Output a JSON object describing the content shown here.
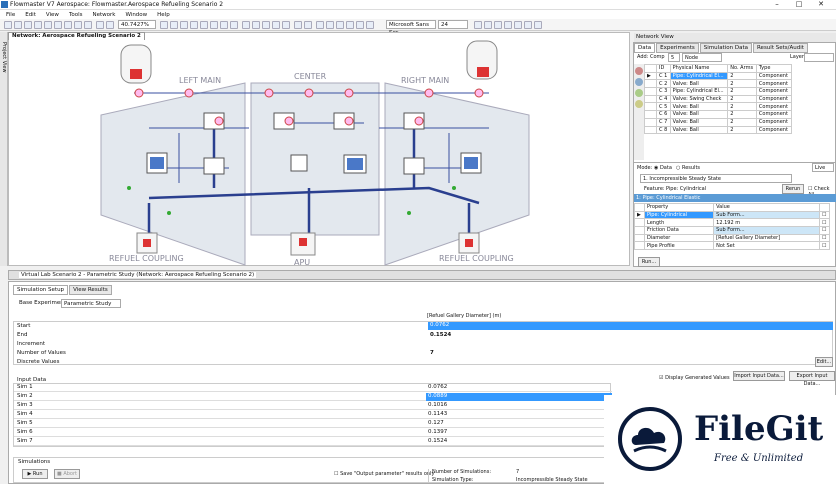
{
  "window": {
    "title": "Flowmaster V7 Aerospace: Flowmaster.Aerospace Refueling Scenario 2"
  },
  "menu": [
    "File",
    "Edit",
    "View",
    "Tools",
    "Network",
    "Window",
    "Help"
  ],
  "toolbar": {
    "zoom": "40.7427%",
    "font": "Microsoft Sans Ser",
    "size": "24"
  },
  "canvas": {
    "tab": "Network: Aerospace Refueling Scenario 2",
    "side_tab": "Project View",
    "labels": {
      "left_main": "LEFT MAIN",
      "center": "CENTER",
      "right_main": "RIGHT MAIN",
      "refuel_left": "REFUEL COUPLING",
      "refuel_right": "REFUEL COUPLING",
      "apu": "APU"
    }
  },
  "netview": {
    "title": "Network View",
    "tabs": [
      "Data",
      "Experiments",
      "Simulation Data",
      "Result Sets/Audit"
    ],
    "add_comp": "Add: Comp",
    "node": "Node",
    "layer": "Layer",
    "columns": [
      "ID",
      "Physical Name",
      "No. Arms",
      "Type"
    ],
    "rows": [
      {
        "id": "C 1",
        "name": "Pipe: Cylindrical El...",
        "arms": "2",
        "type": "Component"
      },
      {
        "id": "C 2",
        "name": "Valve: Ball",
        "arms": "2",
        "type": "Component"
      },
      {
        "id": "C 3",
        "name": "Pipe: Cylindrical El...",
        "arms": "2",
        "type": "Component"
      },
      {
        "id": "C 4",
        "name": "Valve: Swing Check",
        "arms": "2",
        "type": "Component"
      },
      {
        "id": "C 5",
        "name": "Valve: Ball",
        "arms": "2",
        "type": "Component"
      },
      {
        "id": "C 6",
        "name": "Valve: Ball",
        "arms": "2",
        "type": "Component"
      },
      {
        "id": "C 7",
        "name": "Valve: Ball",
        "arms": "2",
        "type": "Component"
      },
      {
        "id": "C 8",
        "name": "Valve: Ball",
        "arms": "2",
        "type": "Component"
      }
    ],
    "mode": "Mode:",
    "data": "Data",
    "results": "Results",
    "live": "Live",
    "scenario": "1. Incompressible Steady State",
    "feature_label": "Feature:",
    "feature": "Pipe: Cylindrical",
    "rerun": "Rerun",
    "check_all": "Check All",
    "prop_header": "1: Pipe: Cylindrical Elastic",
    "prop_cols": [
      "Property",
      "Value"
    ],
    "props": [
      {
        "p": "Pipe: Cylindrical",
        "v": "Sub Form..."
      },
      {
        "p": "Length",
        "v": "12.192 m"
      },
      {
        "p": "Friction Data",
        "v": "Sub Form..."
      },
      {
        "p": "Diameter",
        "v": "[Refuel Gallery Diameter]"
      },
      {
        "p": "Pipe Profile",
        "v": "Not Set"
      }
    ],
    "run": "Run..."
  },
  "bottom": {
    "tab": "Virtual Lab Scenario 2 - Parametric Study (Network: Aerospace Refueling Scenario 2)",
    "subtabs": [
      "Simulation Setup",
      "View Results"
    ],
    "base_label": "Base Experiment:",
    "base": "Parametric Study",
    "col_header": "[Refuel Gallery Diameter] (m)",
    "params": [
      {
        "k": "Start",
        "v": "0.0762"
      },
      {
        "k": "End",
        "v": "0.1524"
      },
      {
        "k": "Increment",
        "v": ""
      },
      {
        "k": "Number of Values",
        "v": "7"
      },
      {
        "k": "Discrete Values",
        "v": ""
      }
    ],
    "edit": "Edit...",
    "input_data": "Input Data",
    "display_gen": "Display Generated Values",
    "import": "Import Input Data...",
    "export": "Export Input Data...",
    "sims": [
      {
        "k": "Sim 1",
        "v": "0.0762"
      },
      {
        "k": "Sim 2",
        "v": "0.0889"
      },
      {
        "k": "Sim 3",
        "v": "0.1016"
      },
      {
        "k": "Sim 4",
        "v": "0.1143"
      },
      {
        "k": "Sim 5",
        "v": "0.127"
      },
      {
        "k": "Sim 6",
        "v": "0.1397"
      },
      {
        "k": "Sim 7",
        "v": "0.1524"
      }
    ],
    "simulations": "Simulations",
    "run": "Run",
    "abort": "Abort",
    "save_output": "Save \"Output parameter\" results only",
    "num_sims_label": "Number of Simulations:",
    "num_sims": "7",
    "sim_type_label": "Simulation Type:",
    "sim_type": "Incompressible Steady State"
  },
  "watermark": {
    "name": "FileGit",
    "tagline": "Free & Unlimited"
  }
}
